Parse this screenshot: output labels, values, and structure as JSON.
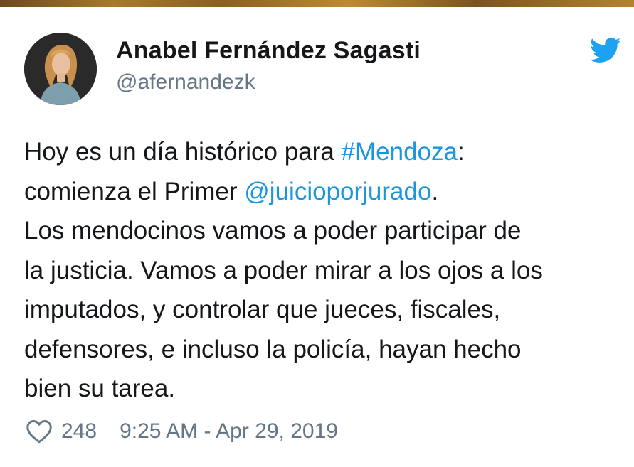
{
  "colors": {
    "text": "#14171a",
    "secondary": "#657786",
    "link": "#1b95e0",
    "twitter_blue": "#1da1f2"
  },
  "author": {
    "name": "Anabel Fernández Sagasti",
    "handle": "@afernandezk",
    "avatar_icon": "profile-photo"
  },
  "logo_icon": "twitter-bird-icon",
  "tweet": {
    "lines": [
      {
        "before": "Hoy es un día histórico para ",
        "link": "#Mendoza",
        "after": ":"
      },
      {
        "before": "comienza el Primer ",
        "link": "@juicioporjurado",
        "after": "."
      },
      {
        "text": "Los mendocinos vamos a poder participar de"
      },
      {
        "text": "la justicia. Vamos a poder mirar a los ojos a los"
      },
      {
        "text": "imputados, y controlar que jueces, fiscales,"
      },
      {
        "text": "defensores, e incluso la policía, hayan hecho"
      },
      {
        "text": "bien su tarea."
      }
    ]
  },
  "footer": {
    "like_icon": "heart-outline-icon",
    "likes": "248",
    "timestamp": "9:25 AM - Apr 29, 2019"
  }
}
